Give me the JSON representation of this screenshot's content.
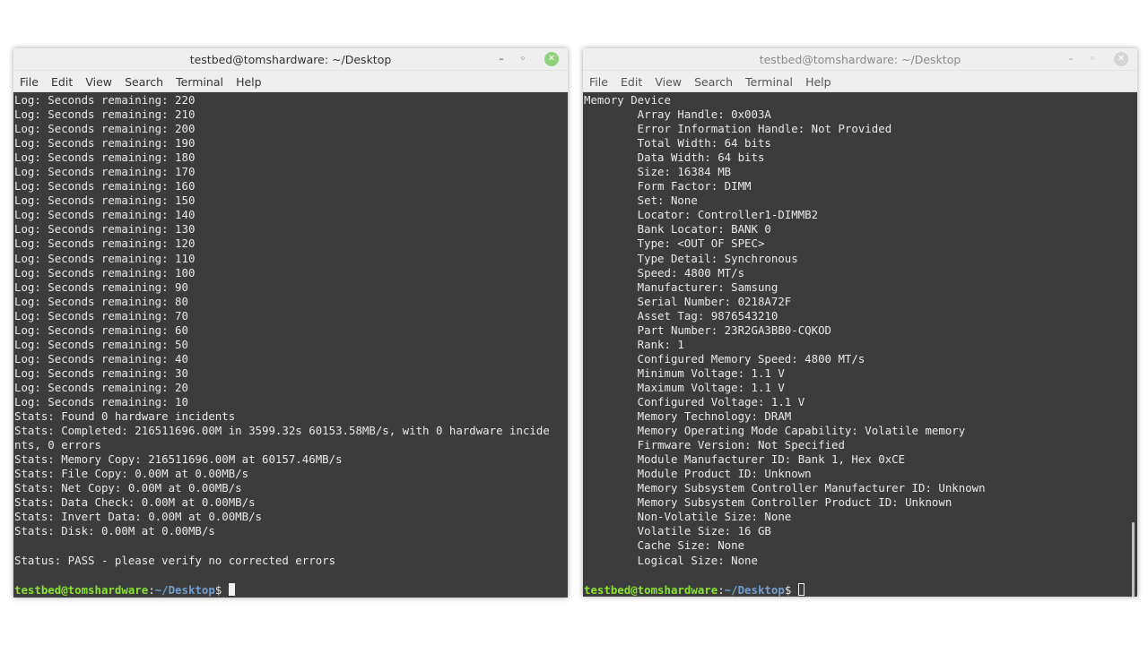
{
  "left_window": {
    "title": "testbed@tomshardware: ~/Desktop",
    "controls": {
      "minimize": "–",
      "maximize": "◦",
      "close": "✕"
    },
    "menu": [
      "File",
      "Edit",
      "View",
      "Search",
      "Terminal",
      "Help"
    ],
    "lines": [
      "Log: Seconds remaining: 220",
      "Log: Seconds remaining: 210",
      "Log: Seconds remaining: 200",
      "Log: Seconds remaining: 190",
      "Log: Seconds remaining: 180",
      "Log: Seconds remaining: 170",
      "Log: Seconds remaining: 160",
      "Log: Seconds remaining: 150",
      "Log: Seconds remaining: 140",
      "Log: Seconds remaining: 130",
      "Log: Seconds remaining: 120",
      "Log: Seconds remaining: 110",
      "Log: Seconds remaining: 100",
      "Log: Seconds remaining: 90",
      "Log: Seconds remaining: 80",
      "Log: Seconds remaining: 70",
      "Log: Seconds remaining: 60",
      "Log: Seconds remaining: 50",
      "Log: Seconds remaining: 40",
      "Log: Seconds remaining: 30",
      "Log: Seconds remaining: 20",
      "Log: Seconds remaining: 10",
      "Stats: Found 0 hardware incidents",
      "Stats: Completed: 216511696.00M in 3599.32s 60153.58MB/s, with 0 hardware incide",
      "nts, 0 errors",
      "Stats: Memory Copy: 216511696.00M at 60157.46MB/s",
      "Stats: File Copy: 0.00M at 0.00MB/s",
      "Stats: Net Copy: 0.00M at 0.00MB/s",
      "Stats: Data Check: 0.00M at 0.00MB/s",
      "Stats: Invert Data: 0.00M at 0.00MB/s",
      "Stats: Disk: 0.00M at 0.00MB/s",
      "",
      "Status: PASS - please verify no corrected errors",
      ""
    ],
    "prompt": {
      "user_host": "testbed@tomshardware",
      "sep": ":",
      "path": "~/Desktop",
      "symbol": "$ "
    }
  },
  "right_window": {
    "title": "testbed@tomshardware: ~/Desktop",
    "controls": {
      "minimize": "–",
      "maximize": "◦",
      "close": "✕"
    },
    "menu": [
      "File",
      "Edit",
      "View",
      "Search",
      "Terminal",
      "Help"
    ],
    "lines": [
      "Memory Device",
      "        Array Handle: 0x003A",
      "        Error Information Handle: Not Provided",
      "        Total Width: 64 bits",
      "        Data Width: 64 bits",
      "        Size: 16384 MB",
      "        Form Factor: DIMM",
      "        Set: None",
      "        Locator: Controller1-DIMMB2",
      "        Bank Locator: BANK 0",
      "        Type: <OUT OF SPEC>",
      "        Type Detail: Synchronous",
      "        Speed: 4800 MT/s",
      "        Manufacturer: Samsung",
      "        Serial Number: 0218A72F",
      "        Asset Tag: 9876543210",
      "        Part Number: 23R2GA3BB0-CQKOD",
      "        Rank: 1",
      "        Configured Memory Speed: 4800 MT/s",
      "        Minimum Voltage: 1.1 V",
      "        Maximum Voltage: 1.1 V",
      "        Configured Voltage: 1.1 V",
      "        Memory Technology: DRAM",
      "        Memory Operating Mode Capability: Volatile memory",
      "        Firmware Version: Not Specified",
      "        Module Manufacturer ID: Bank 1, Hex 0xCE",
      "        Module Product ID: Unknown",
      "        Memory Subsystem Controller Manufacturer ID: Unknown",
      "        Memory Subsystem Controller Product ID: Unknown",
      "        Non-Volatile Size: None",
      "        Volatile Size: 16 GB",
      "        Cache Size: None",
      "        Logical Size: None",
      ""
    ],
    "prompt": {
      "user_host": "testbed@tomshardware",
      "sep": ":",
      "path": "~/Desktop",
      "symbol": "$ "
    }
  }
}
